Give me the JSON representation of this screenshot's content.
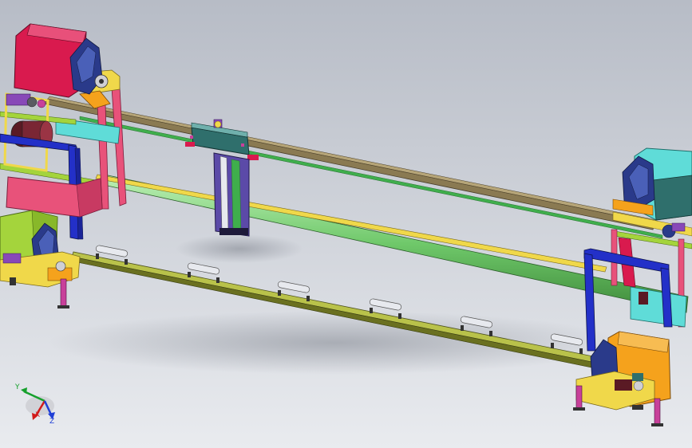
{
  "viewport": {
    "background_top": "#b7bcc6",
    "background_bottom": "#e9ebef"
  },
  "triad": {
    "x_label": "X",
    "y_label": "Y",
    "z_label": "Z",
    "x_color": "#d11a1a",
    "y_color": "#16a02c",
    "z_color": "#1f3fd6"
  },
  "colors": {
    "crimson": "#d91a4e",
    "navy": "#2a3a8a",
    "lime": "#a4d43c",
    "cyan": "#5fdcd8",
    "orange": "#f5a21c",
    "pink": "#e8527a",
    "magenta": "#c8409a",
    "yellow": "#f0d84a",
    "green_tube": "#7ed67a",
    "brown": "#8a7a52",
    "olive": "#b9c24a",
    "blue_frame": "#2330c8",
    "purple": "#8848b8",
    "teal_dark": "#2f6f6c"
  }
}
